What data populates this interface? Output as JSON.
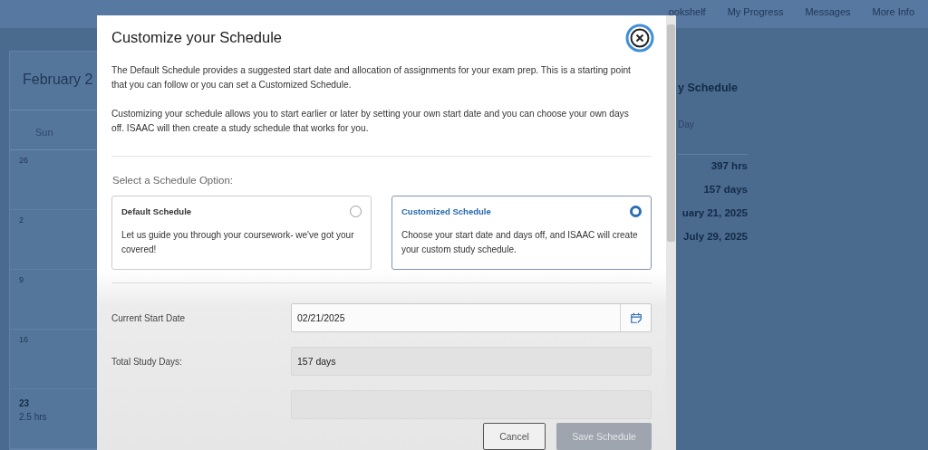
{
  "nav": {
    "links": [
      "ookshelf",
      "My Progress",
      "Messages",
      "More Info"
    ]
  },
  "calendar": {
    "title": "February 2",
    "weekday": "Sun",
    "days": [
      {
        "date": "26",
        "bold": false
      },
      {
        "date": "2",
        "bold": false
      },
      {
        "date": "9",
        "bold": false
      },
      {
        "date": "16",
        "bold": false
      },
      {
        "date": "23",
        "bold": true,
        "hours": "2.5 hrs"
      }
    ]
  },
  "summary": {
    "title": "y Schedule",
    "header": "Day",
    "values": [
      "397 hrs",
      "157 days",
      "uary 21, 2025",
      "July 29, 2025"
    ]
  },
  "modal": {
    "title": "Customize your Schedule",
    "paragraphs": [
      "The Default Schedule provides a suggested start date and allocation of assignments for your exam prep. This is a starting point that you can follow or you can set a Customized Schedule.",
      "Customizing your schedule allows you to start earlier or later by setting your own start date and you can choose your own days off. ISAAC will then create a study schedule that works for you."
    ],
    "option_label": "Select a Schedule Option:",
    "options": [
      {
        "title": "Default Schedule",
        "description": "Let us guide you through your coursework- we've got your covered!",
        "selected": false
      },
      {
        "title": "Customized Schedule",
        "description": "Choose your start date and days off, and ISAAC will create your custom study schedule.",
        "selected": true
      }
    ],
    "fields": [
      {
        "label": "Current Start Date",
        "value": "02/21/2025",
        "kind": "date",
        "readonly": false
      },
      {
        "label": "Total Study Days:",
        "value": "157 days",
        "kind": "text",
        "readonly": true
      },
      {
        "kind": "text",
        "readonly": true
      }
    ],
    "buttons": [
      {
        "label": "Cancel",
        "kind": "secondary",
        "disabled": false
      },
      {
        "label": "Save Schedule",
        "kind": "primary",
        "disabled": true
      }
    ]
  }
}
